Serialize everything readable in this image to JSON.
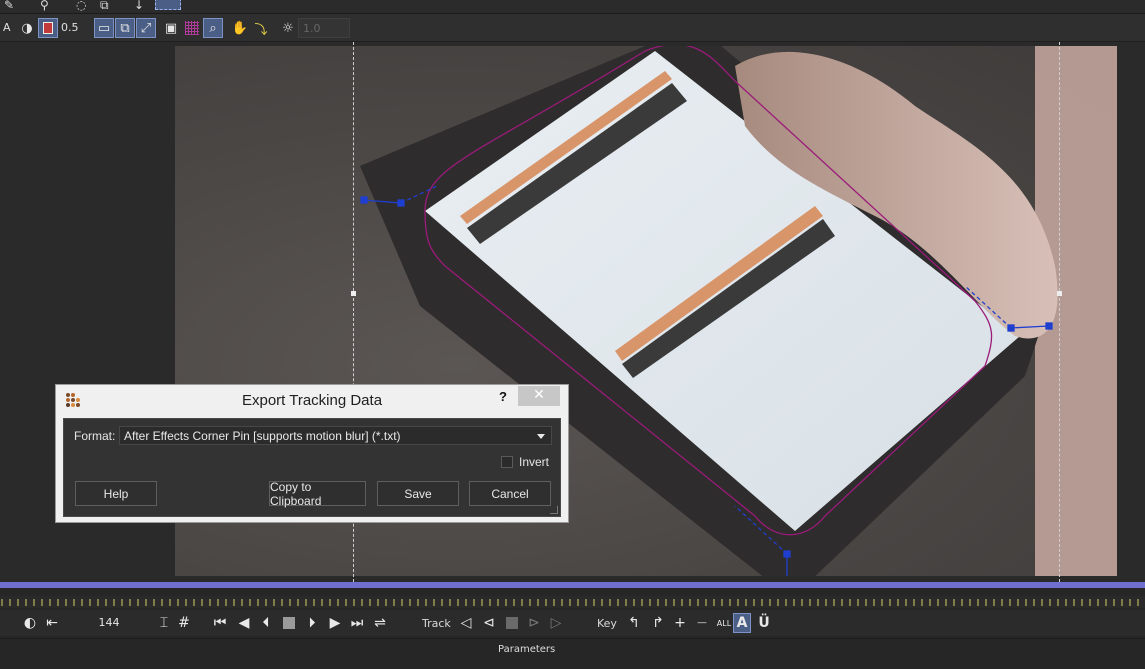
{
  "toolbar": {
    "mode_label": "A",
    "opacity_value": "0.5",
    "frame_field_value": "1.0"
  },
  "dialog": {
    "title": "Export Tracking Data",
    "help_glyph": "?",
    "close_glyph": "✕",
    "format_label": "Format:",
    "format_value": "After Effects Corner Pin [supports motion blur] (*.txt)",
    "invert_label": "Invert",
    "invert_checked": false,
    "buttons": {
      "help": "Help",
      "copy": "Copy to Clipboard",
      "save": "Save",
      "cancel": "Cancel"
    }
  },
  "transport": {
    "frame_number": "144",
    "track_label": "Track",
    "key_label": "Key",
    "a_label": "A",
    "u_label": "Ü",
    "all_label": "ALL"
  },
  "footer": {
    "panel_label": "Parameters"
  },
  "colors": {
    "spline": "#9a1b7a",
    "tracker": "#1f3fd0",
    "timeline": "#6f6fcf",
    "accent_button": "#4a5e86"
  }
}
